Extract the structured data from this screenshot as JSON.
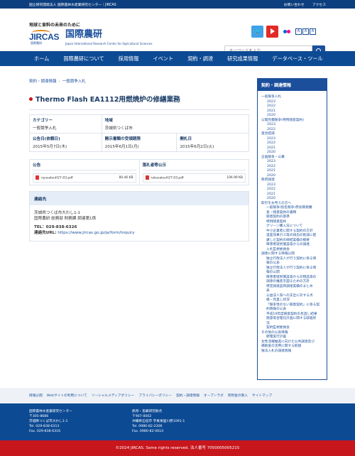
{
  "topbar": {
    "left": "国立研究開発法人 国際農林水産業研究センター｜JIRCAS",
    "links": [
      "お問い合わせ",
      "アクセス"
    ]
  },
  "header": {
    "tagline": "地球と食料の未来のために",
    "logo_mark": "JIRCAS",
    "logo_sub": "国際農研",
    "logo_jp": "国際農研",
    "logo_en": "Japan International Research Center for Agricultural Sciences",
    "search_placeholder": "キーワードを入力",
    "font_sizes": [
      "A",
      "A",
      "A"
    ]
  },
  "nav": [
    "ホーム",
    "国際農研について",
    "採用情報",
    "イベント",
    "契約・調達",
    "研究成果情報",
    "データベース・ツール"
  ],
  "breadcrumb": [
    "契約・調達情報",
    "一般競争入札"
  ],
  "page_title": "Thermo Flash EA1112用燃焼炉の修繕業務",
  "info": {
    "category_label": "カテゴリー",
    "category": "一般競争入札",
    "area_label": "地域",
    "area": "茨城県つくば市",
    "notice_date_label": "公告日(依頼日)",
    "notice_date": "2015年5月7日(木)",
    "doc_period_label": "開示書類の受領期限",
    "doc_period": "2015年6月1日(月)",
    "opening_label": "開札日",
    "opening": "2015年6月2日(火)"
  },
  "attachments": {
    "notice_label": "公告",
    "notice_file": "nyusatsuH27-03.pdf",
    "notice_size": "80.46 KB",
    "result_label": "落札者等公示",
    "result_file": "rakusatsuH27-03.pdf",
    "result_size": "106.99 KB"
  },
  "contact": {
    "label": "連絡先",
    "address": "茨城県つくば市大わし1-1",
    "dept": "国際農研 総務部 財務課 調達第1係",
    "tel": "TEL：029-838-6326",
    "url_label": "連絡先URL:",
    "url": "https://www.jircas.go.jp/ja/form/inquiry"
  },
  "sidebar": {
    "title": "契約・調達情報",
    "items": [
      {
        "t": "一般競争入札",
        "k": "h"
      },
      {
        "t": "2023",
        "k": "y"
      },
      {
        "t": "2022",
        "k": "y"
      },
      {
        "t": "2021",
        "k": "y"
      },
      {
        "t": "2020",
        "k": "y"
      },
      {
        "t": "公開見積競争(特例随意契約)",
        "k": "h"
      },
      {
        "t": "2023",
        "k": "y"
      },
      {
        "t": "2022",
        "k": "y"
      },
      {
        "t": "意見招請",
        "k": "h"
      },
      {
        "t": "2023",
        "k": "y"
      },
      {
        "t": "2022",
        "k": "y"
      },
      {
        "t": "2021",
        "k": "y"
      },
      {
        "t": "2020",
        "k": "y"
      },
      {
        "t": "企画競争・公募",
        "k": "h"
      },
      {
        "t": "2023",
        "k": "y"
      },
      {
        "t": "2022",
        "k": "y"
      },
      {
        "t": "2021",
        "k": "y"
      },
      {
        "t": "2020",
        "k": "y"
      },
      {
        "t": "政府調達",
        "k": "h"
      },
      {
        "t": "2023",
        "k": "y"
      },
      {
        "t": "2022",
        "k": "y"
      },
      {
        "t": "2021",
        "k": "y"
      },
      {
        "t": "2020",
        "k": "y"
      },
      {
        "t": "取引をお考えの方へ",
        "k": "h"
      },
      {
        "t": "一般競争(指名競争)参加資格審",
        "k": "s"
      },
      {
        "t": "査・随意契約の書類",
        "k": "s"
      },
      {
        "t": "随意契約の基準",
        "k": "s"
      },
      {
        "t": "特例随意契約",
        "k": "s"
      },
      {
        "t": "グリーン購入法について",
        "k": "s"
      },
      {
        "t": "中小企業者に関する契約の方針",
        "k": "s"
      },
      {
        "t": "温室効果ガス等の排出の削減に配",
        "k": "s"
      },
      {
        "t": "慮した契約の締結実績の概要",
        "k": "s"
      },
      {
        "t": "障害者就労施設等からの調達",
        "k": "s"
      },
      {
        "t": "入札監視委員会",
        "k": "s"
      },
      {
        "t": "調達に関する情報公開",
        "k": "h"
      },
      {
        "t": "独立行政法人が行う契約に係る情",
        "k": "s"
      },
      {
        "t": "報の公表",
        "k": "s"
      },
      {
        "t": "独立行政法人が行う契約に係る情",
        "k": "s"
      },
      {
        "t": "報の公開",
        "k": "s"
      },
      {
        "t": "障害者就労施設等からの物品等の",
        "k": "s"
      },
      {
        "t": "調達の推進を図るための方針",
        "k": "s"
      },
      {
        "t": "特定調達品目調達実績のまとめ",
        "k": "s"
      },
      {
        "t": "表",
        "k": "s"
      },
      {
        "t": "公益法人等への支出に対する点",
        "k": "s"
      },
      {
        "t": "検・見直し状況",
        "k": "s"
      },
      {
        "t": "「競争性のない随意契約」に係る契",
        "k": "s"
      },
      {
        "t": "約情報の公表",
        "k": "s"
      },
      {
        "t": "平成19年度随意契約の見直し結果",
        "k": "s"
      },
      {
        "t": "随意等合理化計画に関する取組状",
        "k": "s"
      },
      {
        "t": "況",
        "k": "s"
      },
      {
        "t": "契約監視委員会",
        "k": "s"
      },
      {
        "t": "その他の公表情報",
        "k": "h"
      },
      {
        "t": "節電実行計画",
        "k": "s"
      },
      {
        "t": "女性活躍推進に向けた公共調達及び",
        "k": "h"
      },
      {
        "t": "補助金の活用に関する取組",
        "k": "h"
      },
      {
        "t": "独法入札の調達情報",
        "k": "h"
      }
    ]
  },
  "footer_links": [
    "情報公開",
    "Webサイトの利用について",
    "ソーシャルメディアポリシー",
    "プライバシーポリシー",
    "契約・調達情報",
    "オープンラボ",
    "寄附金の受入",
    "サイトマップ"
  ],
  "footer": {
    "left": [
      "国際農林水産業研究センター",
      "〒305-8686",
      "茨城県つくば市大わし1-1",
      "Tel. 029-838-6313",
      "Fax. 029-838-6316"
    ],
    "right": [
      "熱帯・島嶼研究拠点",
      "〒907-0002",
      "沖縄県石垣市 字真栄里川原1091-1",
      "Tel. 0980-82-2306",
      "Fax. 0980-82-0614"
    ]
  },
  "copyright": "©2024 JIRCAS. Some rights reserved. 法人番号 7050005005215",
  "colors": {
    "primary": "#0d4a94",
    "accent": "#c8161d"
  }
}
